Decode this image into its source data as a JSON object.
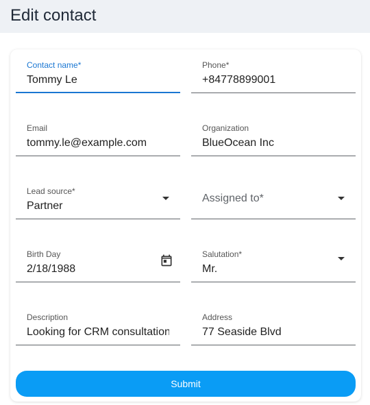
{
  "header": {
    "title": "Edit contact"
  },
  "form": {
    "contact_name": {
      "label": "Contact name*",
      "value": "Tommy Le"
    },
    "phone": {
      "label": "Phone*",
      "value": "+84778899001"
    },
    "email": {
      "label": "Email",
      "value": "tommy.le@example.com"
    },
    "organization": {
      "label": "Organization",
      "value": "BlueOcean Inc"
    },
    "lead_source": {
      "label": "Lead source*",
      "value": "Partner"
    },
    "assigned_to": {
      "placeholder": "Assigned to*"
    },
    "birth_day": {
      "label": "Birth Day",
      "value": "2/18/1988",
      "icon": "calendar-icon"
    },
    "salutation": {
      "label": "Salutation*",
      "value": "Mr."
    },
    "description": {
      "label": "Description",
      "value": "Looking for CRM consultation"
    },
    "address": {
      "label": "Address",
      "value": "77 Seaside Blvd"
    },
    "submit_label": "Submit"
  },
  "colors": {
    "accent": "#1976d2",
    "submit_bg": "#0a9cf5",
    "header_bg": "#eef1f5"
  }
}
